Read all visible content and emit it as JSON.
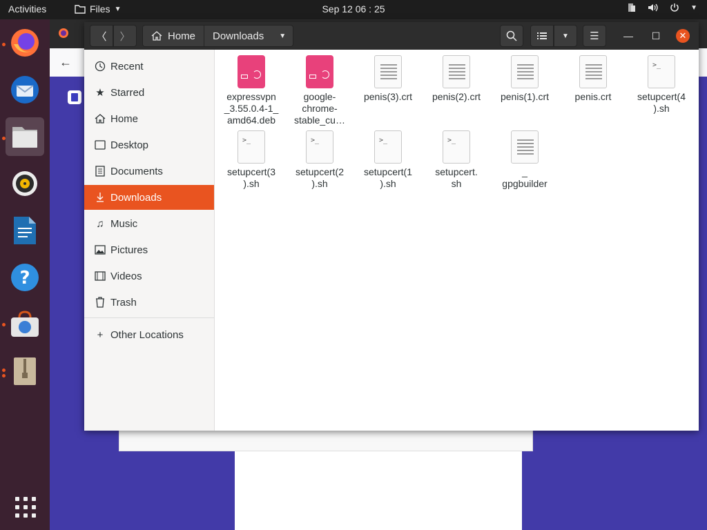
{
  "topbar": {
    "activities": "Activities",
    "app_menu": "Files",
    "clock": "Sep 12  06 : 25"
  },
  "dock": {
    "items": [
      "firefox-icon",
      "thunderbird-icon",
      "files-icon",
      "rhythmbox-icon",
      "writer-icon",
      "help-icon",
      "software-icon",
      "archive-icon"
    ],
    "show_apps": "show-applications-icon"
  },
  "files": {
    "path": {
      "home": "Home",
      "current": "Downloads"
    },
    "sidebar": {
      "items": [
        {
          "label": "Recent",
          "icon": "clock-icon"
        },
        {
          "label": "Starred",
          "icon": "star-icon"
        },
        {
          "label": "Home",
          "icon": "home-icon"
        },
        {
          "label": "Desktop",
          "icon": "desktop-icon"
        },
        {
          "label": "Documents",
          "icon": "documents-icon"
        },
        {
          "label": "Downloads",
          "icon": "download-icon"
        },
        {
          "label": "Music",
          "icon": "music-icon"
        },
        {
          "label": "Pictures",
          "icon": "pictures-icon"
        },
        {
          "label": "Videos",
          "icon": "videos-icon"
        },
        {
          "label": "Trash",
          "icon": "trash-icon"
        }
      ],
      "other_locations": "Other Locations"
    },
    "files": [
      {
        "name_lines": [
          "expressvpn",
          "_3.55.0.4-1_",
          "amd64.deb"
        ],
        "type": "deb"
      },
      {
        "name_lines": [
          "google-",
          "chrome-",
          "stable_cu…"
        ],
        "type": "deb"
      },
      {
        "name_lines": [
          "penis(3).crt"
        ],
        "type": "text"
      },
      {
        "name_lines": [
          "penis(2).crt"
        ],
        "type": "text"
      },
      {
        "name_lines": [
          "penis(1).crt"
        ],
        "type": "text"
      },
      {
        "name_lines": [
          "penis.crt"
        ],
        "type": "text"
      },
      {
        "name_lines": [
          "setupcert(4",
          ").sh"
        ],
        "type": "script"
      },
      {
        "name_lines": [
          "setupcert(3",
          ").sh"
        ],
        "type": "script"
      },
      {
        "name_lines": [
          "setupcert(2",
          ").sh"
        ],
        "type": "script"
      },
      {
        "name_lines": [
          "setupcert(1",
          ").sh"
        ],
        "type": "script"
      },
      {
        "name_lines": [
          "setupcert.",
          "sh"
        ],
        "type": "script"
      },
      {
        "name_lines": [
          "_",
          "gpgbuilder"
        ],
        "type": "text"
      }
    ]
  },
  "colors": {
    "accent": "#e95420",
    "dock": "#3b2130",
    "desktop_bg": "#423aa8"
  }
}
